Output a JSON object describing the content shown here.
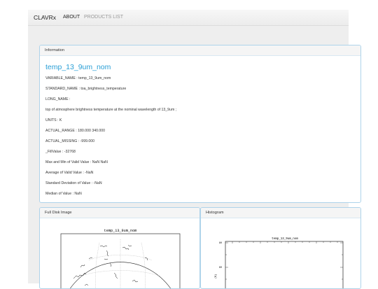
{
  "navbar": {
    "brand": "CLAVRx",
    "about": "ABOUT",
    "products": "PRODUCTS LIST"
  },
  "info_panel": {
    "heading": "Information",
    "variable_title": "temp_13_9um_nom",
    "lines": [
      "VARIABLE_NAME : temp_13_9um_nom",
      "STANDARD_NAME : toa_brightness_temperature",
      "LONG_NAME :",
      "top of atmosphere brightness temperature at the nominal wavelength of 13_9um ;",
      "UNITS : K",
      "ACTUAL_RANGE : 180.000 340.000",
      "ACTUAL_MISSING : -999.000",
      "_FillValue : -32768",
      "Max and Min of Valid Value : NaN NaN",
      "Average of Valid Value : -NaN",
      "Standard Deviation of Value : -NaN",
      "Median of Value : NaN"
    ]
  },
  "disk_panel": {
    "heading": "Full Disk Image",
    "plot_title": "temp_13_9um_nom"
  },
  "hist_panel": {
    "heading": "Histogram",
    "plot_title": "temp_13_9um_nom",
    "y_ticks": [
      "80",
      "60"
    ]
  },
  "colors": {
    "accent": "#2a9fd6",
    "panel_border": "#aed3ea"
  }
}
